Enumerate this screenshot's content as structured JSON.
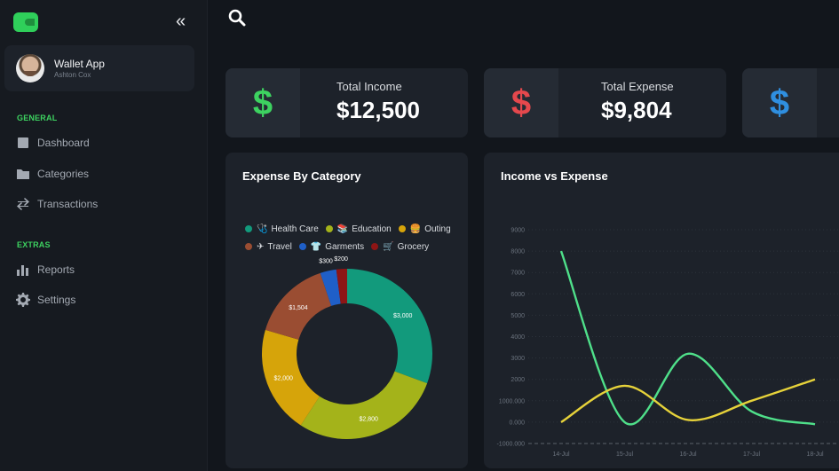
{
  "sidebar": {
    "profile": {
      "name": "Wallet App",
      "subtitle": "Ashton Cox"
    },
    "sections": [
      {
        "title": "GENERAL",
        "items": [
          {
            "label": "Dashboard",
            "icon": "dashboard-icon"
          },
          {
            "label": "Categories",
            "icon": "folder-icon"
          },
          {
            "label": "Transactions",
            "icon": "transfer-icon"
          }
        ]
      },
      {
        "title": "EXTRAS",
        "items": [
          {
            "label": "Reports",
            "icon": "bar-chart-icon"
          },
          {
            "label": "Settings",
            "icon": "gear-icon"
          }
        ]
      }
    ]
  },
  "cards": [
    {
      "label": "Total Income",
      "value": "$12,500",
      "icon": "$",
      "color": "#3dd260"
    },
    {
      "label": "Total Expense",
      "value": "$9,804",
      "icon": "$",
      "color": "#e5484d"
    },
    {
      "label": "",
      "value": "",
      "icon": "$",
      "color": "#2f8fe0"
    }
  ],
  "expense_panel": {
    "title": "Expense By Category"
  },
  "income_panel": {
    "title": "Income vs Expense"
  },
  "chart_data": [
    {
      "type": "pie",
      "title": "Expense By Category",
      "legend": [
        {
          "name": "Health Care",
          "color": "#129a7c",
          "icon": "🩺"
        },
        {
          "name": "Education",
          "color": "#a4b31a",
          "icon": "📚"
        },
        {
          "name": "Outing",
          "color": "#d6a40a",
          "icon": "🍔"
        },
        {
          "name": "Travel",
          "color": "#9a4d32",
          "icon": "✈"
        },
        {
          "name": "Garments",
          "color": "#1f5fc8",
          "icon": "👕"
        },
        {
          "name": "Grocery",
          "color": "#8e1515",
          "icon": "🛒"
        }
      ],
      "slices": [
        {
          "name": "Health Care",
          "value": 3000,
          "label": "$3,000",
          "color": "#129a7c"
        },
        {
          "name": "Education",
          "value": 2800,
          "label": "$2,800",
          "color": "#a4b31a"
        },
        {
          "name": "Outing",
          "value": 2000,
          "label": "$2,000",
          "color": "#d6a40a"
        },
        {
          "name": "Travel",
          "value": 1504,
          "label": "$1,504",
          "color": "#9a4d32"
        },
        {
          "name": "Garments",
          "value": 300,
          "label": "$300",
          "color": "#1f5fc8"
        },
        {
          "name": "Grocery",
          "value": 200,
          "label": "$200",
          "color": "#8e1515"
        }
      ]
    },
    {
      "type": "line",
      "title": "Income vs Expense",
      "x": [
        "14-Jul",
        "15-Jul",
        "16-Jul",
        "17-Jul",
        "18-Jul"
      ],
      "yticks": [
        "-1000.000",
        "0.000",
        "1000.000",
        "2000",
        "3000",
        "4000",
        "5000",
        "6000",
        "7000",
        "8000",
        "9000"
      ],
      "ylim": [
        -1000,
        9000
      ],
      "series": [
        {
          "color": "#4fe08a",
          "values": [
            8000,
            0,
            3200,
            500,
            -100
          ]
        },
        {
          "color": "#e6d23a",
          "values": [
            0,
            1700,
            100,
            1000,
            2000
          ]
        }
      ]
    }
  ]
}
